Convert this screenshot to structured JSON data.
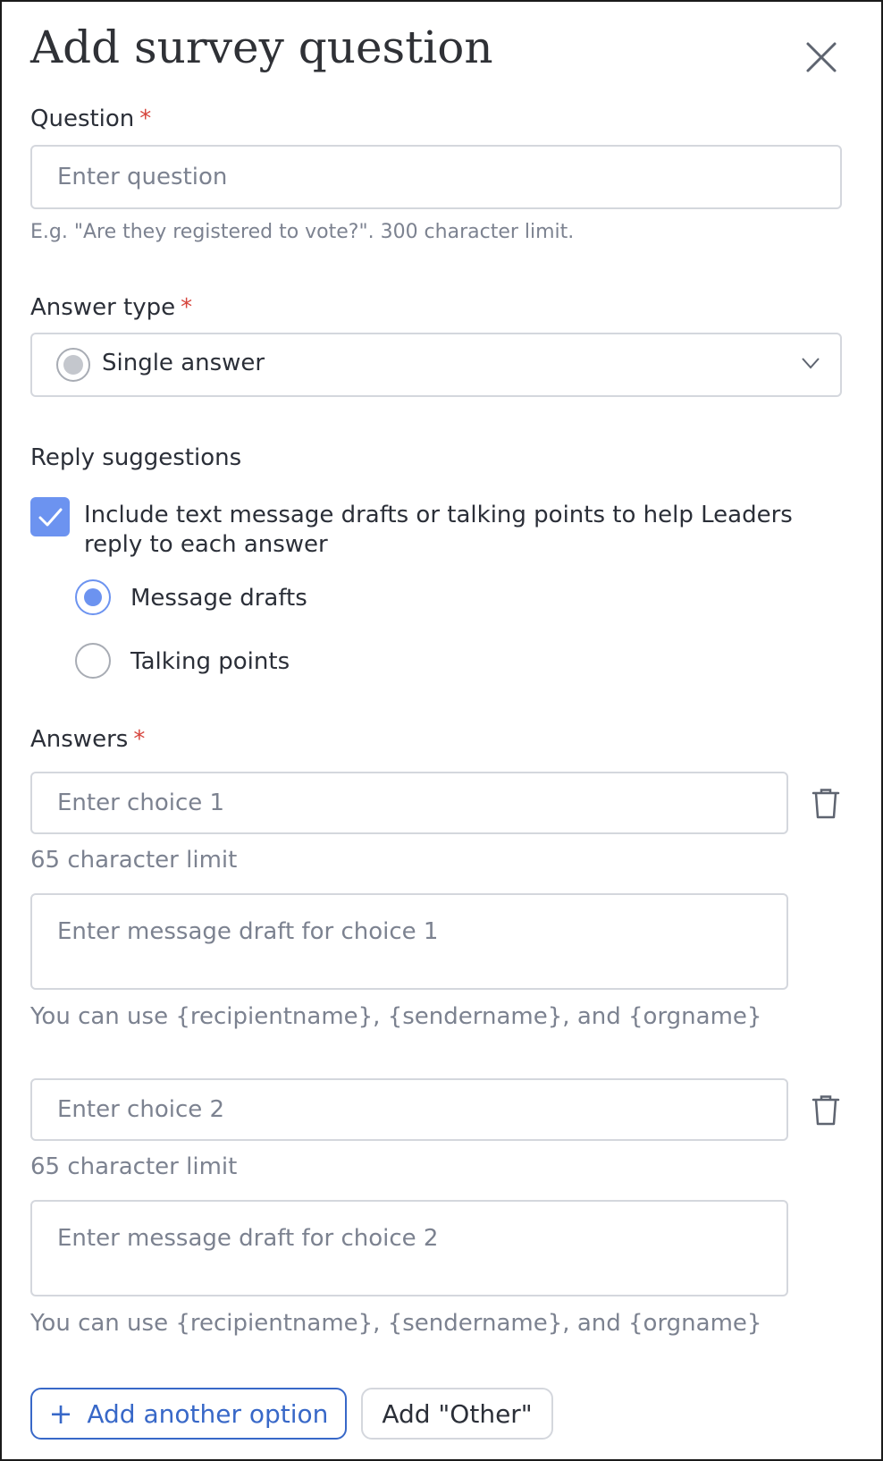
{
  "dialog": {
    "title": "Add survey question"
  },
  "question": {
    "label": "Question",
    "required_mark": "*",
    "placeholder": "Enter question",
    "value": "",
    "hint": "E.g. \"Are they registered to vote?\". 300 character limit."
  },
  "answer_type": {
    "label": "Answer type",
    "required_mark": "*",
    "selected": "Single answer",
    "icon": "radio-icon"
  },
  "reply_suggestions": {
    "label": "Reply suggestions",
    "checkbox_checked": true,
    "checkbox_label_line1": "Include text message drafts or talking points to help Leaders",
    "checkbox_label_line2": "reply to each answer",
    "options": [
      {
        "label": "Message drafts",
        "selected": true
      },
      {
        "label": "Talking points",
        "selected": false
      }
    ]
  },
  "answers": {
    "label": "Answers",
    "required_mark": "*",
    "items": [
      {
        "choice_placeholder": "Enter choice 1",
        "limit_hint": "65 character limit",
        "draft_placeholder": "Enter message draft for choice 1",
        "variables_hint": "You can use {recipientname}, {sendername}, and {orgname}"
      },
      {
        "choice_placeholder": "Enter choice 2",
        "limit_hint": "65 character limit",
        "draft_placeholder": "Enter message draft for choice 2",
        "variables_hint": "You can use {recipientname}, {sendername}, and {orgname}"
      }
    ]
  },
  "actions": {
    "add_option_icon": "+",
    "add_option_label": "Add another option",
    "add_other_label": "Add \"Other\""
  },
  "colors": {
    "accent": "#6c93f0",
    "primary_button": "#3868c8",
    "required": "#d6453d",
    "hint": "#7c8290",
    "border": "#d4d7dd"
  }
}
